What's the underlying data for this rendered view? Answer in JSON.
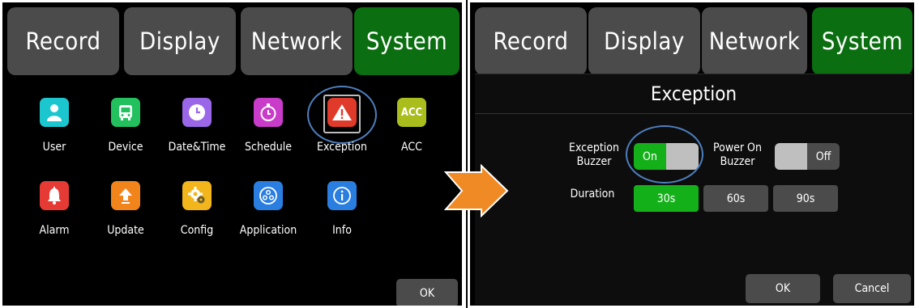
{
  "left": {
    "tabs": [
      "Record",
      "Display",
      "Network",
      "System"
    ],
    "active_tab": "System",
    "tiles": [
      {
        "label": "User",
        "icon": "user-icon",
        "color": "#1cc6cf"
      },
      {
        "label": "Device",
        "icon": "bus-icon",
        "color": "#22c15e"
      },
      {
        "label": "Date&Time",
        "icon": "clock-icon",
        "color": "#9a67e8"
      },
      {
        "label": "Schedule",
        "icon": "stopwatch-icon",
        "color": "#c93bc9"
      },
      {
        "label": "Exception",
        "icon": "warning-icon",
        "color": "#e03a2a"
      },
      {
        "label": "ACC",
        "icon": "acc-icon",
        "color": "#a9bd1c"
      },
      {
        "label": "Alarm",
        "icon": "bell-icon",
        "color": "#e63b34"
      },
      {
        "label": "Update",
        "icon": "upload-arrow-icon",
        "color": "#f2841c"
      },
      {
        "label": "Config",
        "icon": "gear-icon",
        "color": "#f2b61c"
      },
      {
        "label": "Application",
        "icon": "apps-icon",
        "color": "#2a7ee0"
      },
      {
        "label": "Info",
        "icon": "info-icon",
        "color": "#2a7ee0"
      }
    ],
    "acc_text": "ACC",
    "ok_label": "OK"
  },
  "right": {
    "tabs": [
      "Record",
      "Display",
      "Network",
      "System"
    ],
    "active_tab": "System",
    "dialog_title": "Exception",
    "exception_buzzer_label": [
      "Exception",
      "Buzzer"
    ],
    "exception_buzzer_state": "On",
    "power_on_buzzer_label": [
      "Power On",
      "Buzzer"
    ],
    "power_on_buzzer_state": "Off",
    "duration_label": "Duration",
    "durations": [
      "30s",
      "60s",
      "90s"
    ],
    "selected_duration": "30s",
    "ok_label": "OK",
    "cancel_label": "Cancel"
  },
  "colors": {
    "tab_bg": "#4b4b4b",
    "tab_active": "#0b6e10",
    "toggle_on": "#14b01a",
    "highlight_ring": "#4d7fbf",
    "arrow": "#f08a24"
  }
}
